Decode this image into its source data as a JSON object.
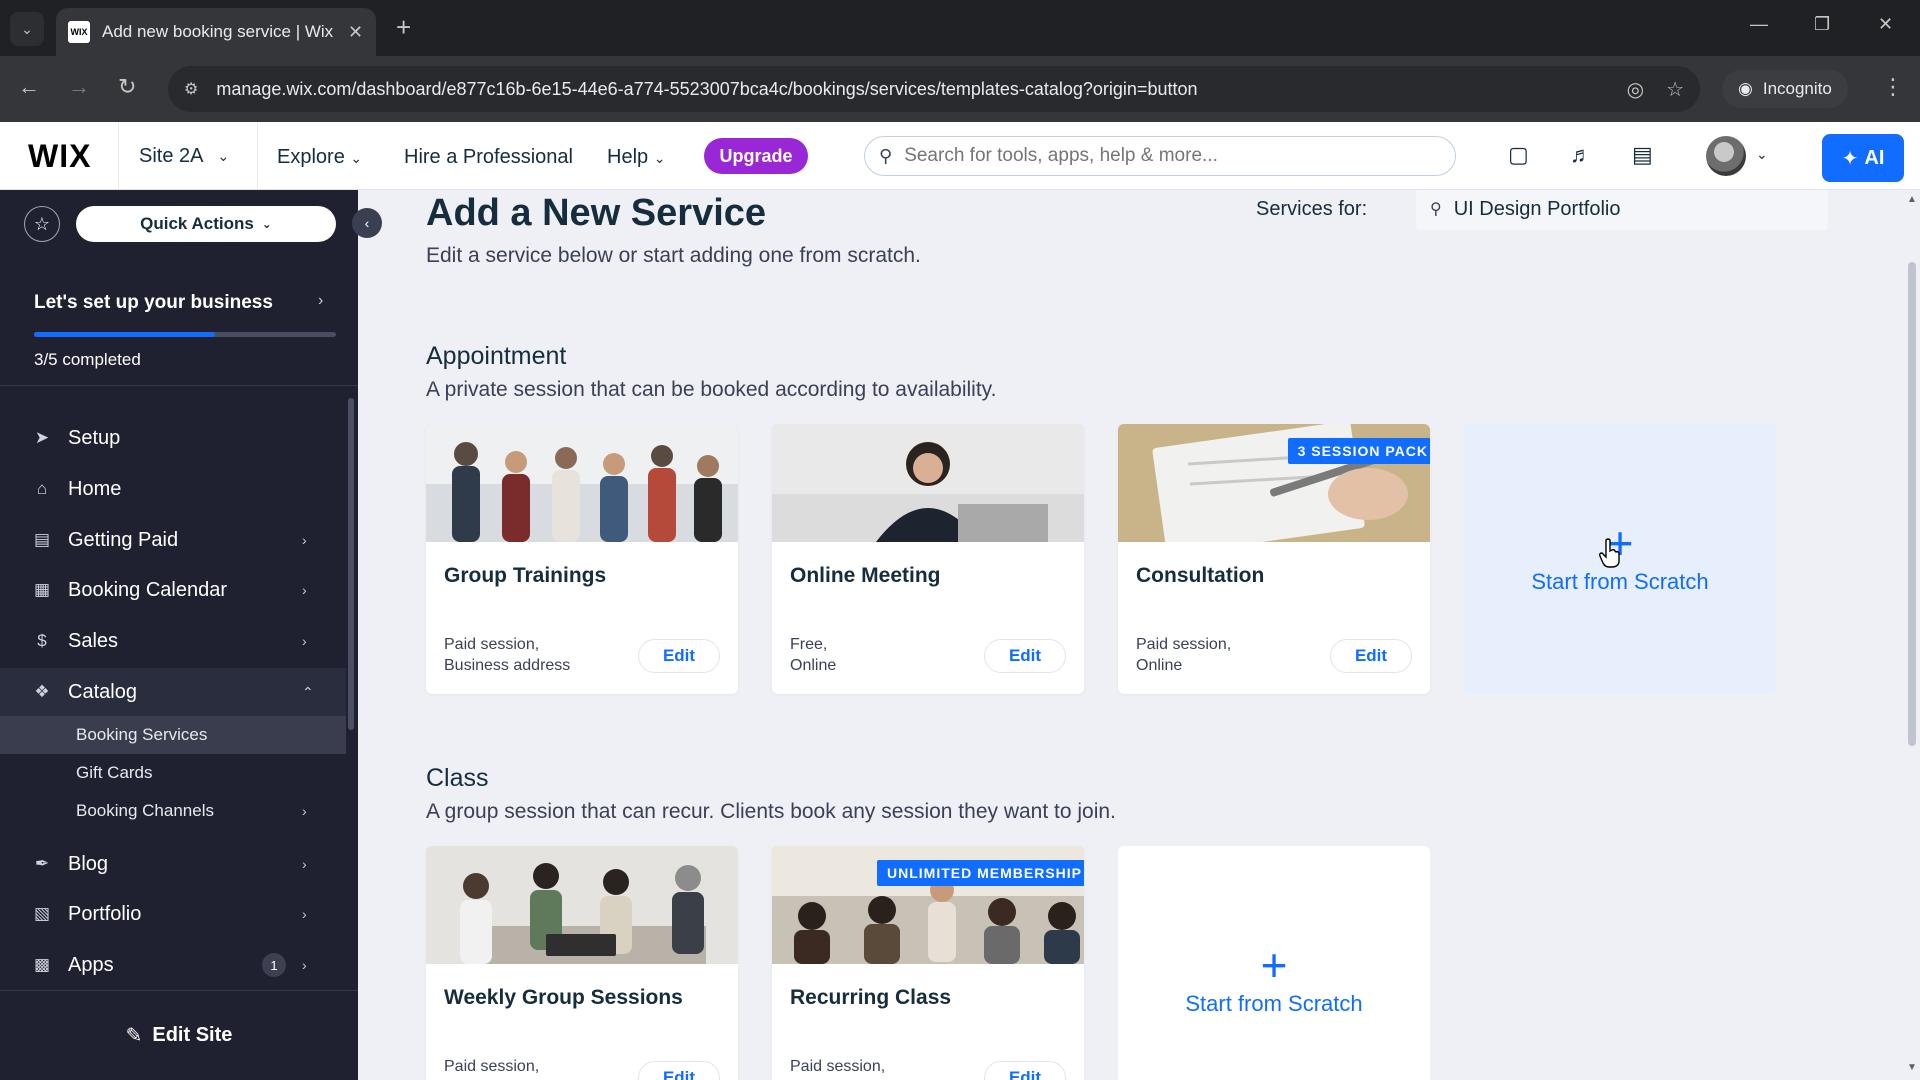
{
  "browser": {
    "tab_title": "Add new booking service | Wix",
    "favicon_text": "WIX",
    "url": "manage.wix.com/dashboard/e877c16b-6e15-44e6-a774-5523007bca4c/bookings/services/templates-catalog?origin=button",
    "incognito_label": "Incognito"
  },
  "header": {
    "logo": "WIX",
    "site_name": "Site 2A",
    "explore": "Explore",
    "hire": "Hire a Professional",
    "help": "Help",
    "upgrade": "Upgrade",
    "search_placeholder": "Search for tools, apps, help & more...",
    "ai_label": "AI"
  },
  "sidebar": {
    "quick_actions": "Quick Actions",
    "setup_title": "Let's set up your business",
    "setup_count": "3/5 completed",
    "setup_progress": 0.6,
    "items": [
      {
        "label": "Setup"
      },
      {
        "label": "Home"
      },
      {
        "label": "Getting Paid"
      },
      {
        "label": "Booking Calendar"
      },
      {
        "label": "Sales"
      },
      {
        "label": "Catalog"
      },
      {
        "label": "Blog"
      },
      {
        "label": "Portfolio"
      },
      {
        "label": "Apps",
        "badge": "1"
      }
    ],
    "catalog_sub": [
      {
        "label": "Booking Services"
      },
      {
        "label": "Gift Cards"
      },
      {
        "label": "Booking Channels"
      }
    ],
    "edit_site": "Edit Site"
  },
  "main": {
    "title": "Add a New Service",
    "subtitle": "Edit a service below or start adding one from scratch.",
    "services_for_label": "Services for:",
    "services_for_value": "UI Design Portfolio",
    "appointment": {
      "title": "Appointment",
      "subtitle": "A private session that can be booked according to availability.",
      "cards": [
        {
          "name": "Group Trainings",
          "desc1": "Paid session,",
          "desc2": "Business address",
          "edit": "Edit"
        },
        {
          "name": "Online Meeting",
          "desc1": "Free,",
          "desc2": "Online",
          "edit": "Edit"
        },
        {
          "name": "Consultation",
          "desc1": "Paid session,",
          "desc2": "Online",
          "edit": "Edit",
          "tag": "3 SESSION PACK"
        }
      ],
      "scratch": "Start from Scratch"
    },
    "class": {
      "title": "Class",
      "subtitle": "A group session that can recur. Clients book any session they want to join.",
      "cards": [
        {
          "name": "Weekly Group Sessions",
          "desc1": "Paid session,",
          "edit": "Edit"
        },
        {
          "name": "Recurring Class",
          "desc1": "Paid session,",
          "edit": "Edit",
          "tag": "UNLIMITED MEMBERSHIP"
        }
      ],
      "scratch": "Start from Scratch"
    }
  },
  "colors": {
    "accent": "#116dff",
    "upgrade": "#9a27d5",
    "sidebar_bg": "#1f2130"
  }
}
